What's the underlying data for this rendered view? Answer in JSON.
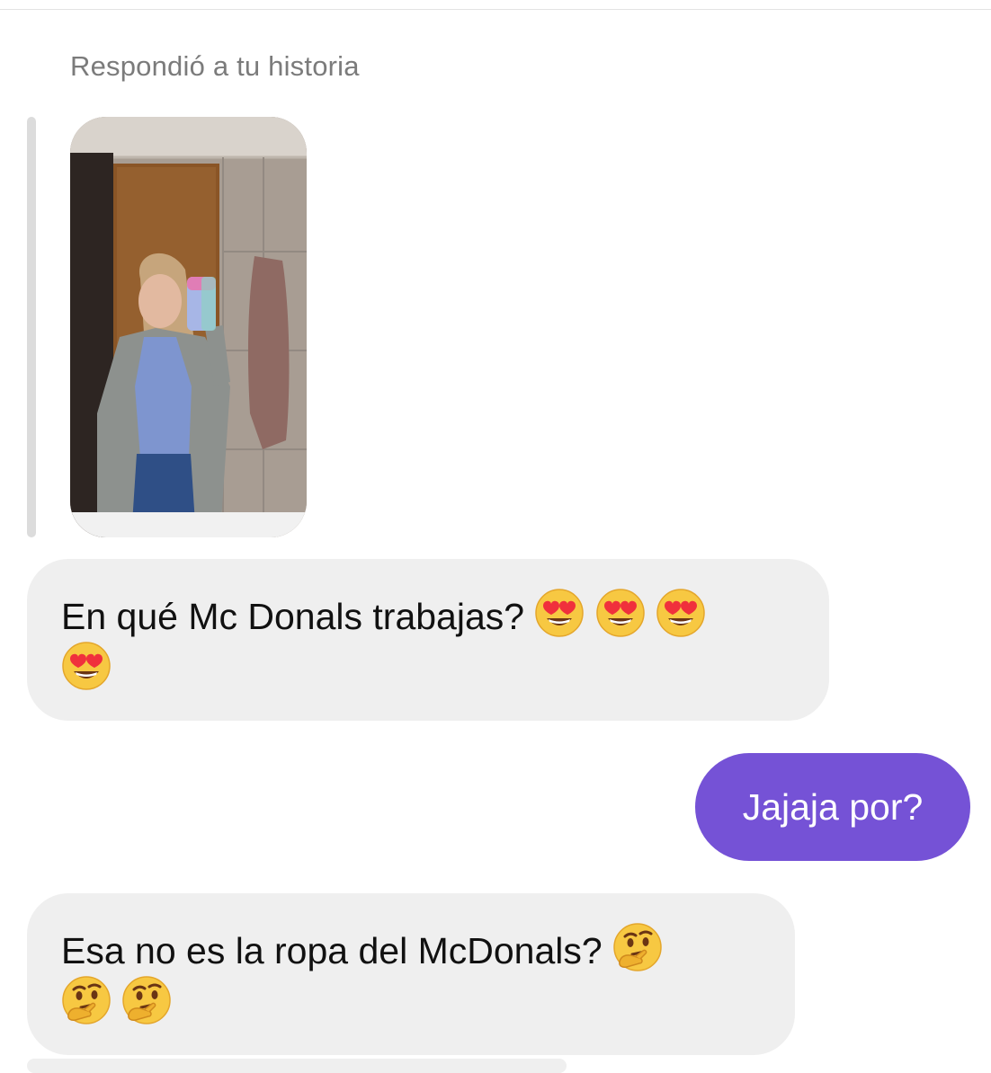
{
  "story_reply": {
    "label": "Respondió a tu historia",
    "thumbnail": "story-photo"
  },
  "messages": [
    {
      "direction": "incoming",
      "text": "En qué Mc Donals trabajas?",
      "emojis": [
        "heart-eyes-emoji",
        "heart-eyes-emoji",
        "heart-eyes-emoji",
        "heart-eyes-emoji"
      ]
    },
    {
      "direction": "outgoing",
      "text": "Jajaja por?"
    },
    {
      "direction": "incoming",
      "text": "Esa no es la ropa del McDonals?",
      "emojis": [
        "thinking-face-emoji",
        "thinking-face-emoji",
        "thinking-face-emoji"
      ]
    }
  ],
  "colors": {
    "outgoing_bubble": "#7552d6",
    "incoming_bubble": "#efefef",
    "label_gray": "#7b7b7b"
  }
}
